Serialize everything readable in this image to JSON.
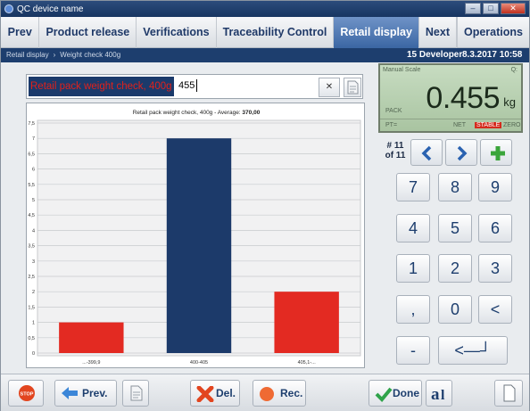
{
  "window": {
    "title": "QC device name"
  },
  "menu": {
    "prev": "Prev",
    "product_release": "Product release",
    "verifications": "Verifications",
    "traceability": "Traceability Control",
    "retail_display": "Retail display",
    "next": "Next",
    "operations": "Operations"
  },
  "status": {
    "crumb1": "Retail display",
    "crumb2": "Weight check 400g",
    "user": "15 Developer",
    "datetime": "8.3.2017 10:58"
  },
  "entry": {
    "label": "Retail pack weight check, 400g",
    "value": "455"
  },
  "scale": {
    "name": "Manual Scale",
    "q": "Q:",
    "pack": "PACK",
    "weight": "0.455",
    "unit": "kg",
    "pt": "PT=",
    "net": "NET",
    "stable": "STABLE",
    "zero": "ZERO"
  },
  "counter": {
    "index": "# 11",
    "of": "of 11"
  },
  "keypad": [
    "7",
    "8",
    "9",
    "4",
    "5",
    "6",
    "1",
    "2",
    "3",
    ",",
    "0",
    "<",
    "-",
    "<—┘"
  ],
  "buttons": {
    "prev": "Prev.",
    "del": "Del.",
    "rec": "Rec.",
    "done": "Done"
  },
  "chart_data": {
    "type": "bar",
    "title": "Retail pack weight check, 400g - Average: ",
    "title_value": "370,00",
    "categories": [
      "...-399,9",
      "400-405",
      "405,1-..."
    ],
    "values": [
      1,
      7,
      2
    ],
    "colors": [
      "#e32a22",
      "#1c3a6a",
      "#e32a22"
    ],
    "ylim": [
      0,
      7.5
    ],
    "yticks": [
      "0",
      "0,5",
      "1",
      "1,5",
      "2",
      "2,5",
      "3",
      "3,5",
      "4",
      "4,5",
      "5",
      "5,5",
      "6",
      "6,5",
      "7",
      "7,5"
    ],
    "grid": true
  }
}
